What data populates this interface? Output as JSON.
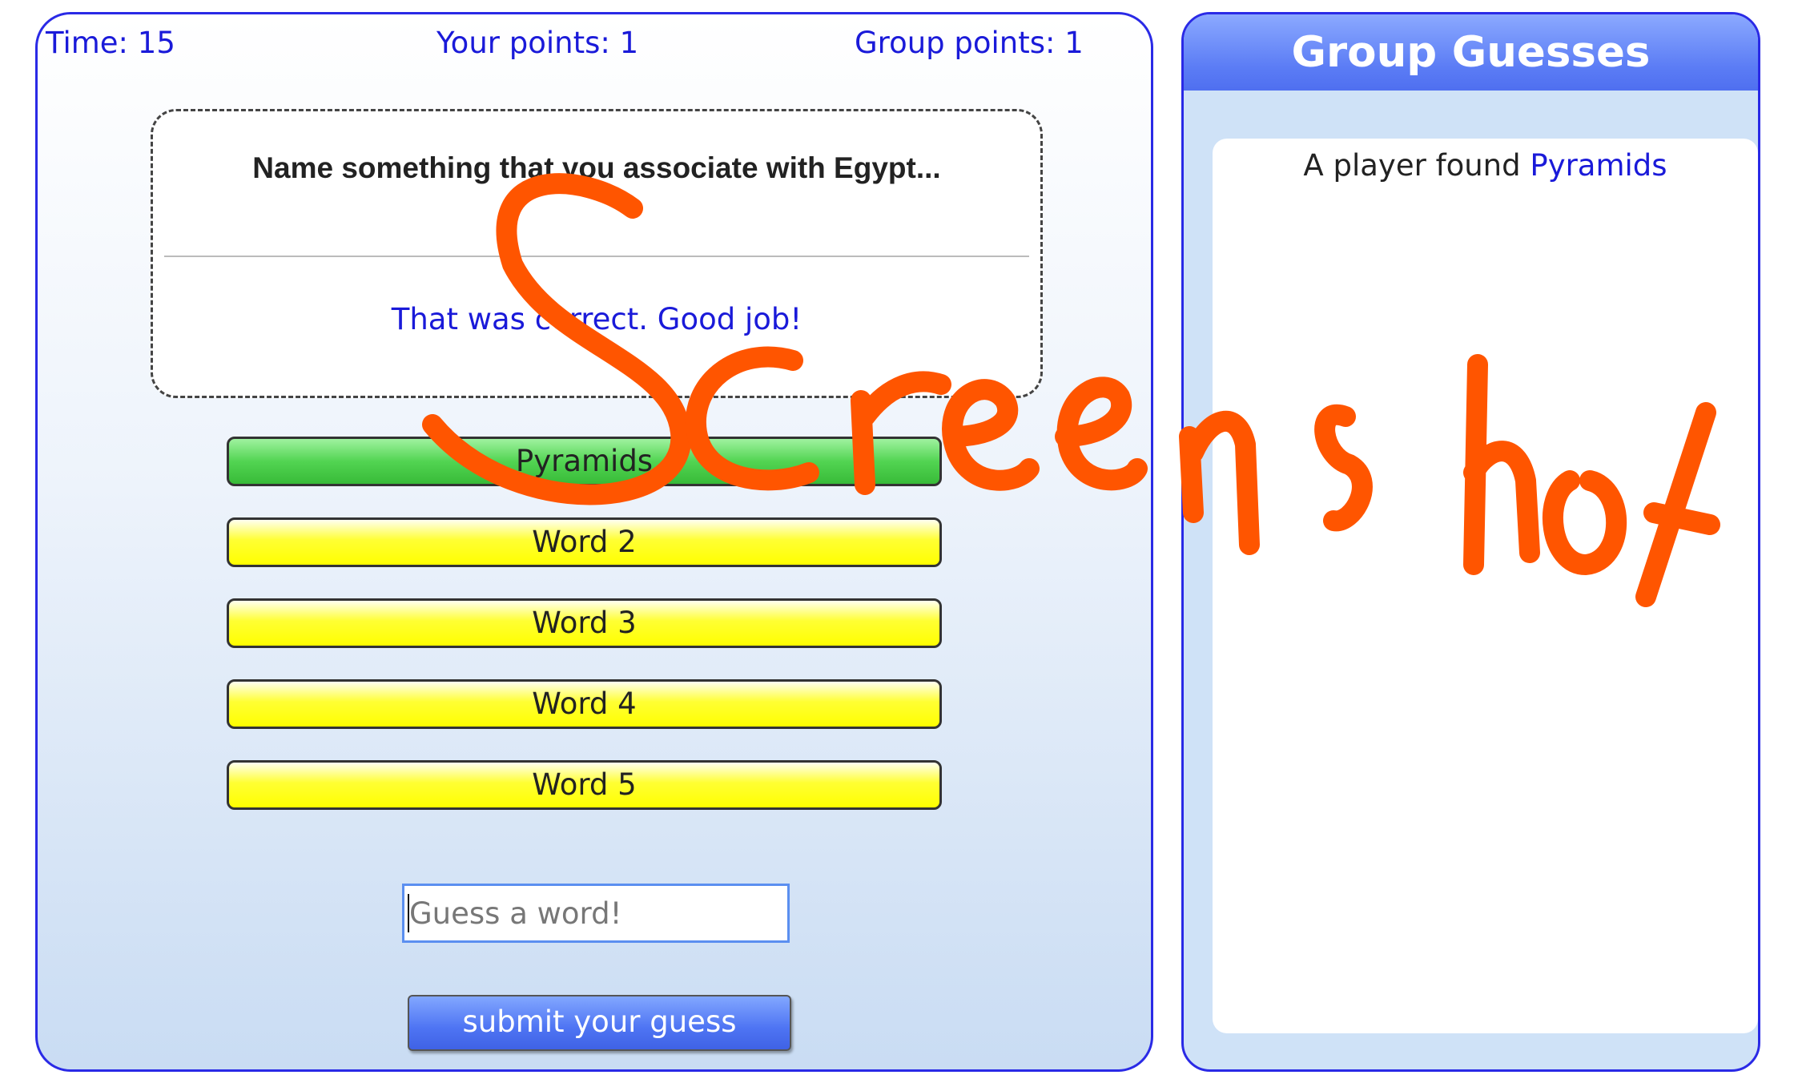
{
  "stats": {
    "time": "Time: 15",
    "your_points": "Your points: 1",
    "group_points": "Group points: 1"
  },
  "prompt": {
    "question": "Name something that you associate with Egypt...",
    "feedback": "That was correct. Good job!"
  },
  "words": [
    {
      "label": "Pyramids",
      "status": "found"
    },
    {
      "label": "Word 2",
      "status": "hidden"
    },
    {
      "label": "Word 3",
      "status": "hidden"
    },
    {
      "label": "Word 4",
      "status": "hidden"
    },
    {
      "label": "Word 5",
      "status": "hidden"
    }
  ],
  "guess": {
    "placeholder": "Guess a word!",
    "value": "",
    "submit_label": "submit your guess"
  },
  "group": {
    "title": "Group Guesses",
    "entries": [
      {
        "prefix": "A player found ",
        "word": "Pyramids"
      }
    ]
  },
  "watermark": {
    "text": "Screenshot",
    "color": "#ff5500"
  },
  "colors": {
    "border_blue": "#2a2ae6",
    "text_blue": "#1a1ad9",
    "found_green": "#52d452",
    "hidden_yellow": "#ffff00",
    "button_blue": "#4e74f3"
  }
}
